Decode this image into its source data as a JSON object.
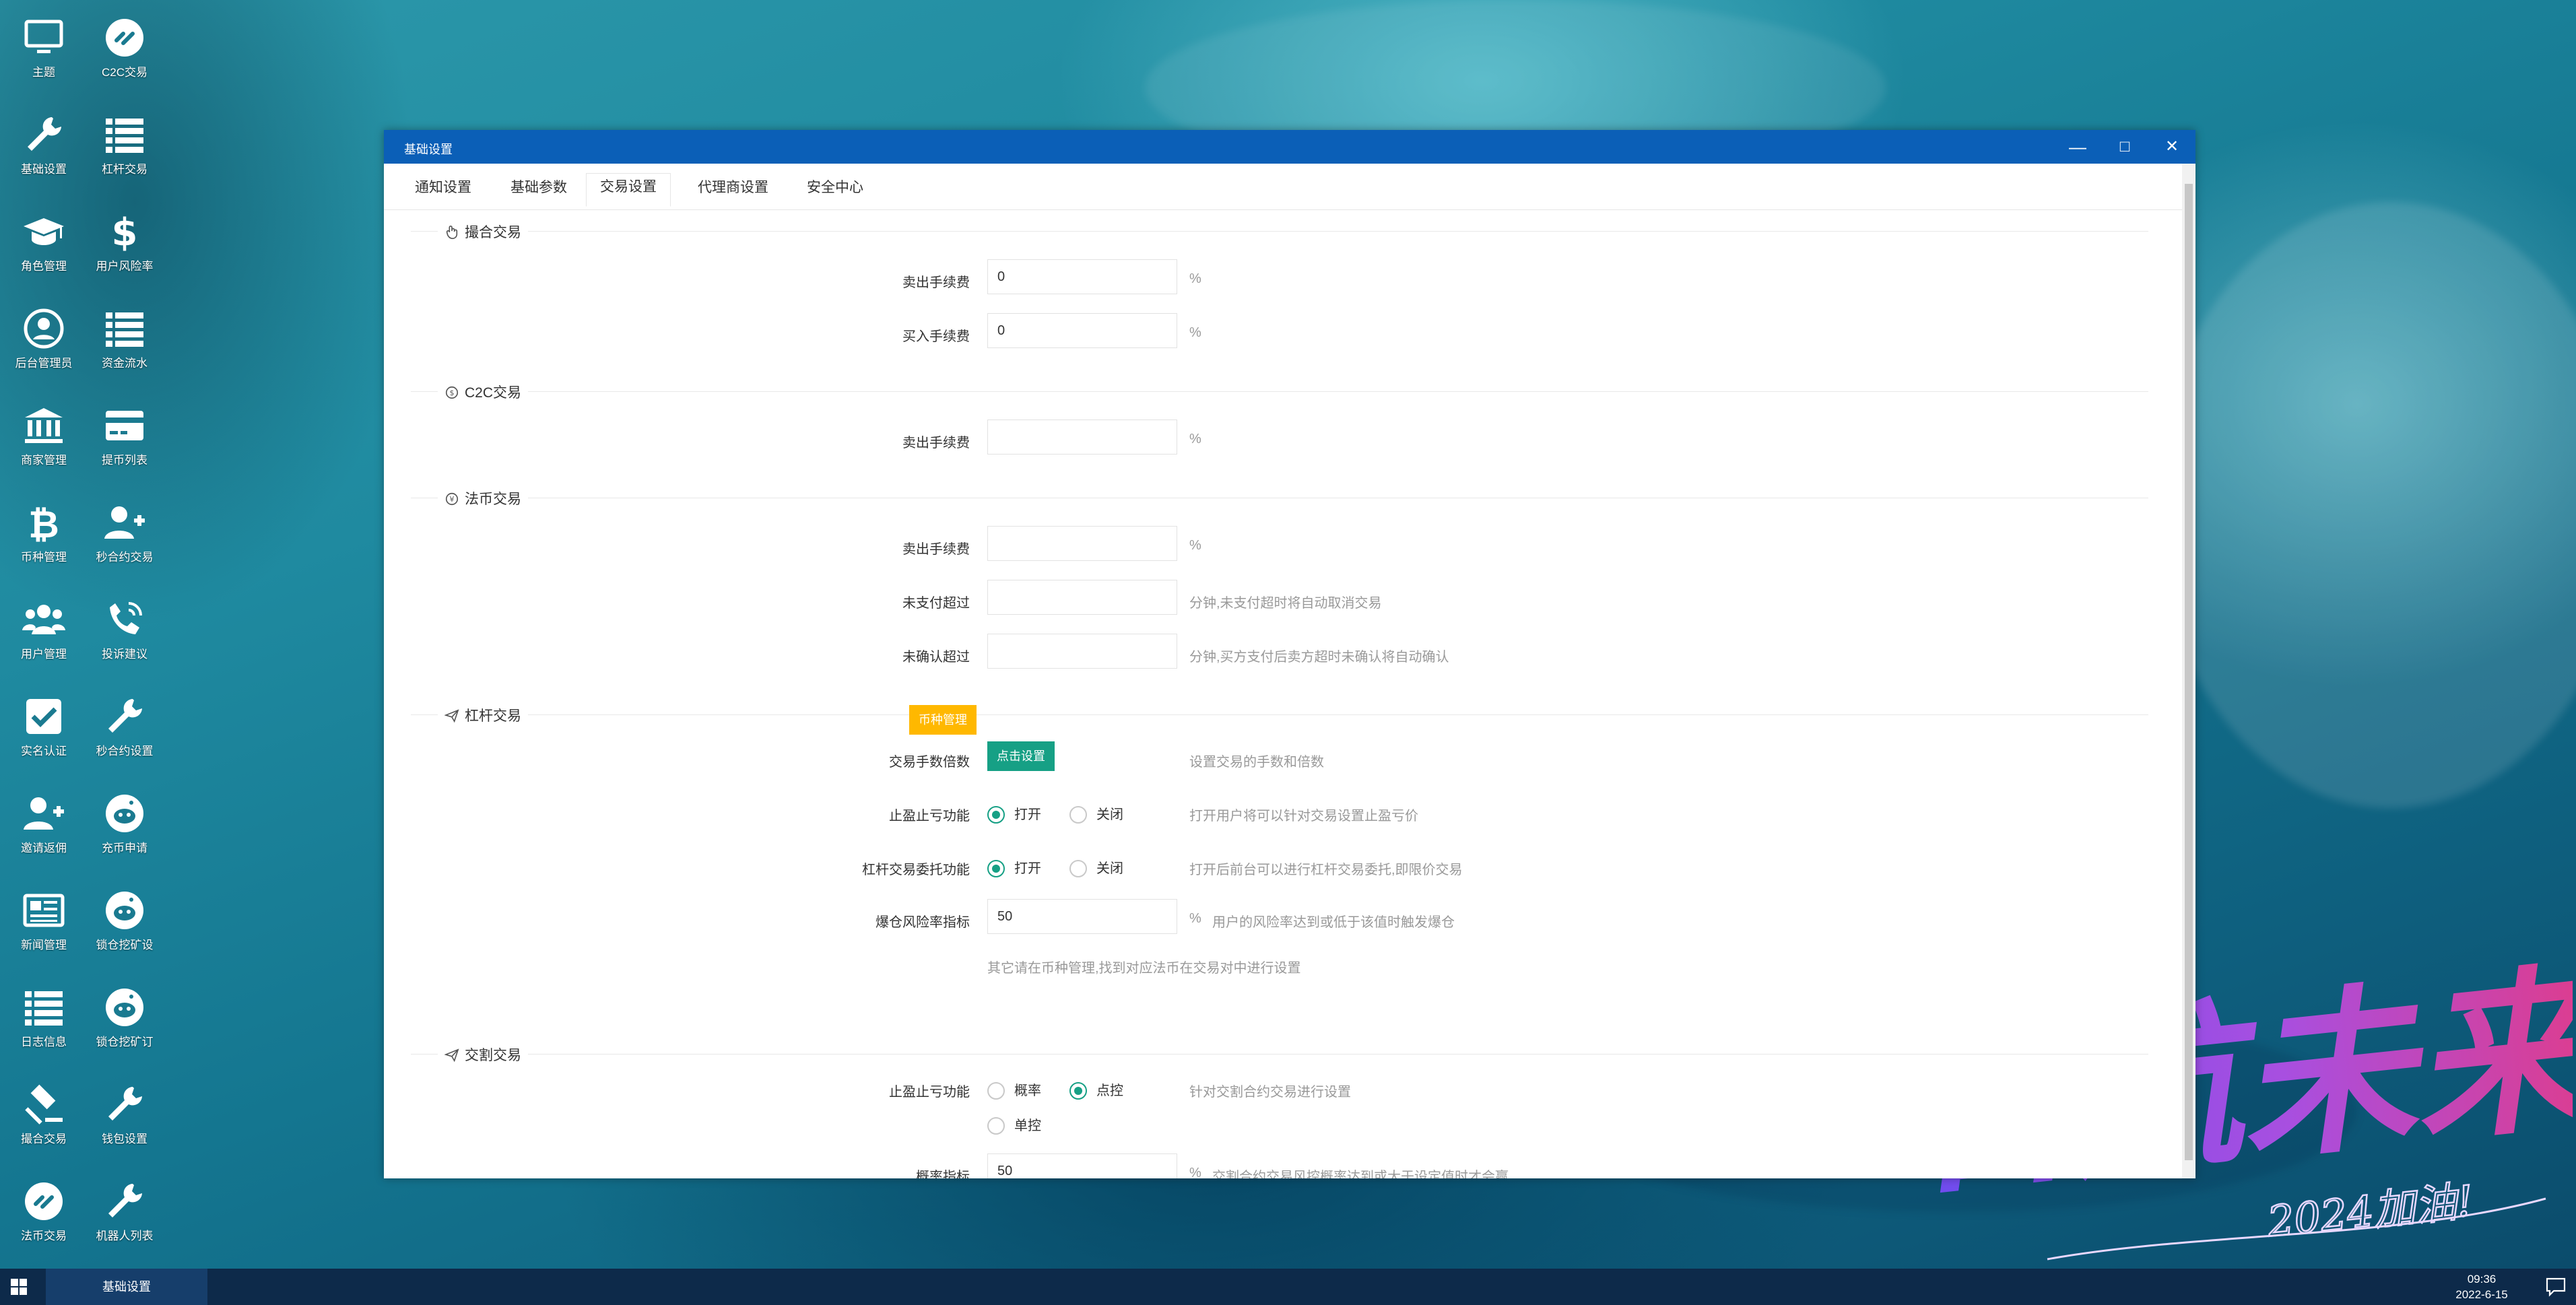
{
  "desktop": {
    "icons": [
      {
        "label": "主题",
        "icon": "monitor-icon"
      },
      {
        "label": "C2C交易",
        "icon": "exchange-icon"
      },
      {
        "label": "基础设置",
        "icon": "wrench-icon"
      },
      {
        "label": "杠杆交易",
        "icon": "list-icon"
      },
      {
        "label": "角色管理",
        "icon": "graduation-cap-icon"
      },
      {
        "label": "用户风险率",
        "icon": "dollar-icon"
      },
      {
        "label": "后台管理员",
        "icon": "user-circle-icon"
      },
      {
        "label": "资金流水",
        "icon": "list-icon"
      },
      {
        "label": "商家管理",
        "icon": "bank-icon"
      },
      {
        "label": "提币列表",
        "icon": "credit-card-icon"
      },
      {
        "label": "币种管理",
        "icon": "bitcoin-icon"
      },
      {
        "label": "秒合约交易",
        "icon": "user-plus-icon"
      },
      {
        "label": "用户管理",
        "icon": "users-icon"
      },
      {
        "label": "投诉建议",
        "icon": "phone-icon"
      },
      {
        "label": "实名认证",
        "icon": "check-square-icon"
      },
      {
        "label": "秒合约设置",
        "icon": "wrench-icon"
      },
      {
        "label": "邀请返佣",
        "icon": "user-plus-icon"
      },
      {
        "label": "充币申请",
        "icon": "reddit-icon"
      },
      {
        "label": "新闻管理",
        "icon": "newspaper-icon"
      },
      {
        "label": "锁仓挖矿设",
        "icon": "reddit-icon"
      },
      {
        "label": "日志信息",
        "icon": "list-icon"
      },
      {
        "label": "锁仓挖矿订",
        "icon": "reddit-icon"
      },
      {
        "label": "撮合交易",
        "icon": "gavel-icon"
      },
      {
        "label": "钱包设置",
        "icon": "wrench-icon"
      },
      {
        "label": "法币交易",
        "icon": "exchange-icon"
      },
      {
        "label": "机器人列表",
        "icon": "wrench-icon"
      }
    ]
  },
  "window": {
    "title": "基础设置",
    "controls": {
      "minimize": "—",
      "maximize": "□",
      "close": "✕"
    },
    "tabs": [
      {
        "label": "通知设置",
        "active": false
      },
      {
        "label": "基础参数",
        "active": false
      },
      {
        "label": "交易设置",
        "active": true
      },
      {
        "label": "代理商设置",
        "active": false
      },
      {
        "label": "安全中心",
        "active": false
      }
    ]
  },
  "form": {
    "match": {
      "legend": "撮合交易",
      "sell_fee_label": "卖出手续费",
      "sell_fee_value": "0",
      "sell_fee_unit": "%",
      "buy_fee_label": "买入手续费",
      "buy_fee_value": "0",
      "buy_fee_unit": "%"
    },
    "c2c": {
      "legend": "C2C交易",
      "sell_fee_label": "卖出手续费",
      "sell_fee_value": "",
      "sell_fee_unit": "%"
    },
    "fiat": {
      "legend": "法币交易",
      "sell_fee_label": "卖出手续费",
      "sell_fee_value": "",
      "sell_fee_unit": "%",
      "unpaid_label": "未支付超过",
      "unpaid_value": "",
      "unpaid_hint": "分钟,未支付超时将自动取消交易",
      "unconfirmed_label": "未确认超过",
      "unconfirmed_value": "",
      "unconfirmed_hint": "分钟,买方支付后卖方超时未确认将自动确认"
    },
    "lever": {
      "legend": "杠杆交易",
      "coin_btn": "币种管理",
      "multiplier_label": "交易手数倍数",
      "multiplier_btn": "点击设置",
      "multiplier_hint": "设置交易的手数和倍数",
      "stop_label": "止盈止亏功能",
      "stop_on": "打开",
      "stop_off": "关闭",
      "stop_hint": "打开用户将可以针对交易设置止盈亏价",
      "entrust_label": "杠杆交易委托功能",
      "entrust_on": "打开",
      "entrust_off": "关闭",
      "entrust_hint": "打开后前台可以进行杠杆交易委托,即限价交易",
      "risk_label": "爆仓风险率指标",
      "risk_value": "50",
      "risk_unit": "%",
      "risk_hint": "用户的风险率达到或低于该值时触发爆仓",
      "note": "其它请在币种管理,找到对应法币在交易对中进行设置"
    },
    "delivery": {
      "legend": "交割交易",
      "stop_label": "止盈止亏功能",
      "opt_prob": "概率",
      "opt_point": "点控",
      "opt_single": "单控",
      "stop_hint": "针对交割合约交易进行设置",
      "prob_label": "概率指标",
      "prob_value": "50",
      "prob_unit": "%",
      "prob_hint": "交割合约交易风控概率达到或大于设定值时才会赢"
    }
  },
  "taskbar": {
    "task_label": "基础设置",
    "time": "09:36",
    "date": "2022-6-15"
  },
  "watermark": {
    "text": "启航未来",
    "sub": "2024加油!"
  },
  "colors": {
    "titlebar": "#0b5fb7",
    "accent": "#16a085",
    "warning": "#ffb800",
    "taskbar": "#0d2a4a"
  }
}
